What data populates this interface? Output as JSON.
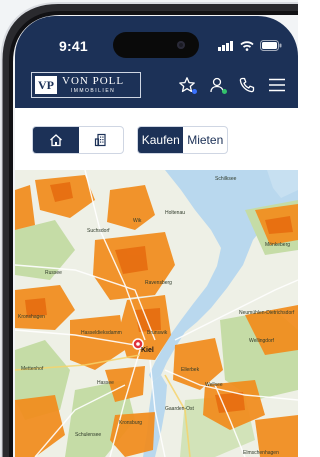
{
  "status_bar": {
    "time": "9:41"
  },
  "brand": {
    "initials": "VP",
    "name": "VON POLL",
    "subtitle": "IMMOBILIEN"
  },
  "header_icons": [
    "star-icon",
    "user-icon",
    "phone-icon",
    "menu-icon"
  ],
  "colors": {
    "navy": "#1c3157",
    "orange": "#f28c1c",
    "water": "#b9d8ee",
    "green": "#a8c98a",
    "pin": "#e0323c",
    "fav_dot": "#3a72ff",
    "user_dot": "#33c26b"
  },
  "filters": {
    "property_types": [
      {
        "icon": "house-icon",
        "active": true
      },
      {
        "icon": "building-icon",
        "active": false
      }
    ],
    "mode": [
      {
        "label": "Kaufen",
        "active": true
      },
      {
        "label": "Mieten",
        "active": false
      }
    ]
  },
  "map": {
    "city_label": "Kiel",
    "place_labels": [
      "Kronshagen",
      "Wellsee",
      "Ellerbek",
      "Gaarden-Ost",
      "Russee",
      "Suchsdorf",
      "Wik",
      "Holtenau",
      "Schilksee",
      "Mönkeberg",
      "Neumühlen-Dietrichsdorf",
      "Wellingdorf",
      "Elmschenhagen",
      "Schulensee",
      "Hasseldieksdamm",
      "Hassee",
      "Kronsburg",
      "Ravensberg",
      "Brunswik",
      "Mettenhof"
    ]
  }
}
